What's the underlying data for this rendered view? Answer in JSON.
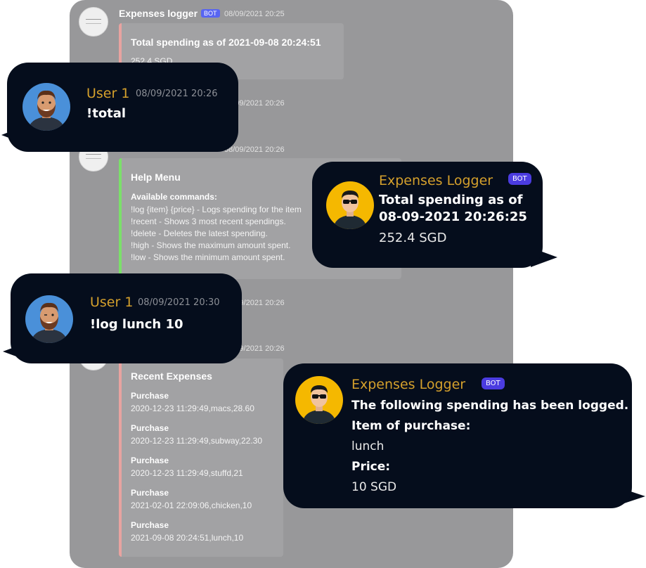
{
  "background_chat": {
    "msg1": {
      "author": "Expenses logger",
      "badge": "BOT",
      "time": "08/09/2021 20:25",
      "embed_title": "Total spending as of 2021-09-08 20:24:51",
      "embed_value": "252.4 SGD",
      "embed_accent": "#e8a3a0"
    },
    "msg2_time": "08/09/2021 20:26",
    "msg3": {
      "time": "08/09/2021 20:26",
      "embed_title": "Help Menu",
      "embed_subtitle": "Available commands:",
      "embed_accent": "#7be06a",
      "commands": [
        "!log {item} {price} - Logs spending for the item",
        "!recent - Shows 3 most recent spendings.",
        "!delete - Deletes the latest spending.",
        "!high - Shows the maximum amount spent.",
        "!low - Shows the minimum amount spent."
      ]
    },
    "msg4_time": "08/09/2021 20:26",
    "msg5": {
      "time": "08/09/2021 20:26",
      "embed_title": "Recent Expenses",
      "embed_accent": "#e8a3a0",
      "items": [
        {
          "label": "Purchase",
          "value": "2020-12-23 11:29:49,macs,28.60"
        },
        {
          "label": "Purchase",
          "value": "2020-12-23 11:29:49,subway,22.30"
        },
        {
          "label": "Purchase",
          "value": "2020-12-23 11:29:49,stuffd,21"
        },
        {
          "label": "Purchase",
          "value": "2021-02-01 22:09:06,chicken,10"
        },
        {
          "label": "Purchase",
          "value": "2021-09-08 20:24:51,lunch,10"
        }
      ]
    }
  },
  "bubbles": {
    "user_total": {
      "name": "User 1",
      "time": "08/09/2021 20:26",
      "text": "!total"
    },
    "bot_total": {
      "name": "Expenses Logger",
      "badge": "BOT",
      "line1": "Total spending as of",
      "line2": "08-09-2021 20:26:25",
      "line3": "252.4 SGD"
    },
    "user_log": {
      "name": "User 1",
      "time": "08/09/2021 20:30",
      "text": "!log lunch 10"
    },
    "bot_logged": {
      "name": "Expenses Logger",
      "badge": "BOT",
      "line1": "The following spending has been logged.",
      "item_label": "Item of purchase:",
      "item_value": "lunch",
      "price_label": "Price:",
      "price_value": "10 SGD"
    }
  },
  "colors": {
    "bubble_bg": "#050d1c",
    "name_gold": "#d4a02c",
    "badge_purple": "#4b3ce0",
    "panel_gray": "#98989a",
    "user_avatar_bg": "#4a90d9",
    "bot_avatar_bg": "#f5b800"
  },
  "icons": {
    "user_avatar": "bearded-man-avatar",
    "bot_avatar": "sunglasses-man-avatar",
    "bg_avatar": "bot-logo-avatar"
  }
}
